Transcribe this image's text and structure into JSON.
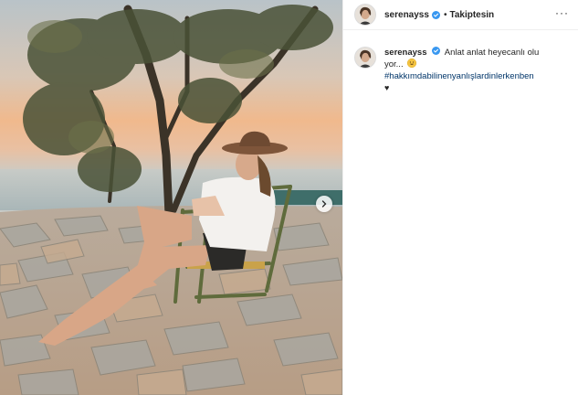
{
  "post": {
    "username": "serenayss",
    "follow_separator": "•",
    "follow_label": "Takiptesin",
    "more_label": "···",
    "caption": {
      "username": "serenayss",
      "text": "Anlat anlat heyecanlı oluyor...",
      "emoji": "grinning-face",
      "hashtag": "#hakkımdabilinenyanlışlardinlerkenben",
      "trailing": "♥"
    }
  },
  "colors": {
    "verified": "#3897f0",
    "hashtag": "#003569",
    "text": "#262626",
    "divider": "#efefef"
  },
  "icons": [
    "verified-badge-icon",
    "more-options-icon",
    "next-arrow-icon",
    "heart-icon",
    "emoji-icon"
  ]
}
